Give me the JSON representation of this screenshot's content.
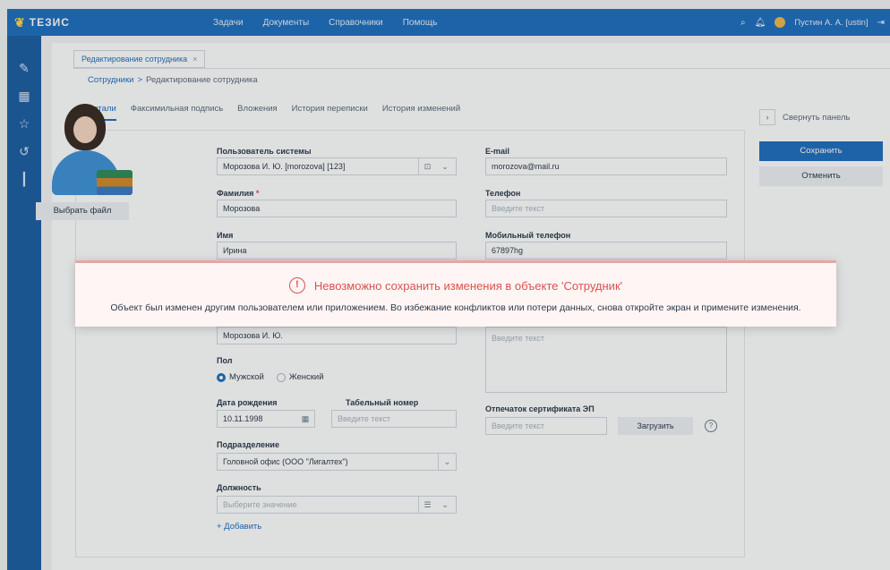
{
  "app": {
    "logo": "ТЕЗИС"
  },
  "topnav": [
    "Задачи",
    "Документы",
    "Справочники",
    "Помощь"
  ],
  "user": {
    "name": "Пустин А. А. [ustin]"
  },
  "doc_tab": {
    "label": "Редактирование сотрудника",
    "close": "×"
  },
  "breadcrumb": {
    "parent": "Сотрудники",
    "sep": ">",
    "current": "Редактирование сотрудника"
  },
  "subtabs": [
    "Детали",
    "Факсимильная подпись",
    "Вложения",
    "История переписки",
    "История изменений"
  ],
  "photo": {
    "choose_file": "Выбрать файл"
  },
  "form": {
    "system_user": {
      "label": "Пользователь системы",
      "value": "Морозова И. Ю. [morozova] [123]"
    },
    "last_name": {
      "label": "Фамилия",
      "required": "*",
      "value": "Морозова"
    },
    "first_name": {
      "label": "Имя",
      "value": "Ирина"
    },
    "short_name": {
      "value": "Морозова И. Ю."
    },
    "gender": {
      "label": "Пол",
      "male": "Мужской",
      "female": "Женский",
      "selected": "male"
    },
    "birth_date": {
      "label": "Дата рождения",
      "value": "10.11.1998"
    },
    "tab_number": {
      "label": "Табельный номер",
      "placeholder": "Введите текст"
    },
    "department": {
      "label": "Подразделение",
      "value": "Головной офис (ООО \"Лигалтех\")"
    },
    "position": {
      "label": "Должность",
      "placeholder": "Выберите значение",
      "add": "+ Добавить"
    },
    "email": {
      "label": "E-mail",
      "value": "morozova@mail.ru"
    },
    "phone": {
      "label": "Телефон",
      "placeholder": "Введите текст"
    },
    "mobile": {
      "label": "Мобильный телефон",
      "value": "67897hg"
    },
    "notes": {
      "placeholder": "Введите текст"
    },
    "cert": {
      "label": "Отпечаток сертификата ЭП",
      "placeholder": "Введите текст",
      "upload": "Загрузить",
      "help": "?"
    }
  },
  "side_panel": {
    "collapse": "Свернуть панель",
    "save": "Сохранить",
    "cancel": "Отменить"
  },
  "toast": {
    "icon": "!",
    "title": "Невозможно сохранить изменения в объекте 'Сотрудник'",
    "message": "Объект был изменен другим пользователем или приложением. Во избежание конфликтов или потери данных, снова откройте экран и примените изменения."
  },
  "colors": {
    "primary": "#1f6fbf",
    "sidebar": "#1d5fa4",
    "error": "#d9534f",
    "toast_bg": "#fff5f5"
  }
}
